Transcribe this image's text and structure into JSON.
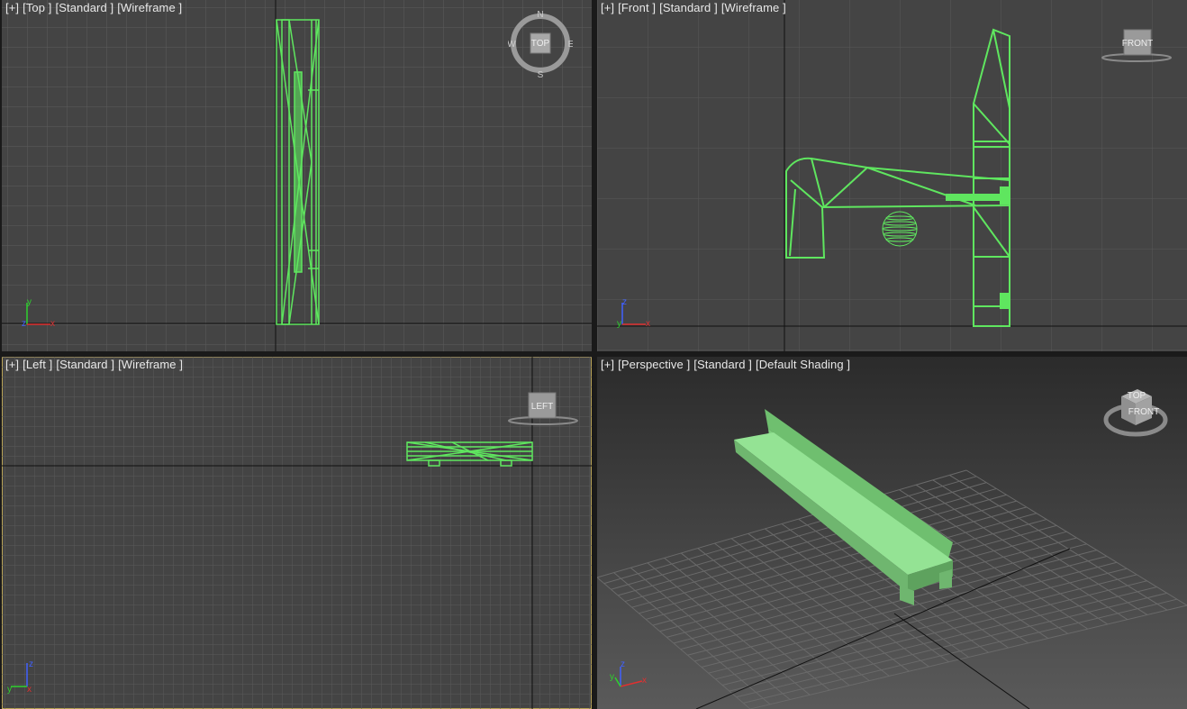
{
  "viewports": {
    "top": {
      "plus": "[+]",
      "view": "[Top ]",
      "mode": "[Standard ]",
      "shading": "[Wireframe ]"
    },
    "front": {
      "plus": "[+]",
      "view": "[Front ]",
      "mode": "[Standard ]",
      "shading": "[Wireframe ]"
    },
    "left": {
      "plus": "[+]",
      "view": "[Left ]",
      "mode": "[Standard ]",
      "shading": "[Wireframe ]"
    },
    "persp": {
      "plus": "[+]",
      "view": "[Perspective ]",
      "mode": "[Standard ]",
      "shading": "[Default Shading ]"
    }
  },
  "compass": {
    "n": "N",
    "s": "S",
    "w": "W",
    "e": "E",
    "cube": "TOP"
  },
  "viewcube": {
    "front": "FRONT",
    "left": "LEFT",
    "persp_right": "FRONT",
    "persp_top": "TOP"
  },
  "axes": {
    "x": "x",
    "y": "y",
    "z": "z"
  },
  "colors": {
    "wire": "#5fe65f",
    "shaded": "#8ee08e",
    "active_border": "#b9a356",
    "bg": "#444444"
  }
}
